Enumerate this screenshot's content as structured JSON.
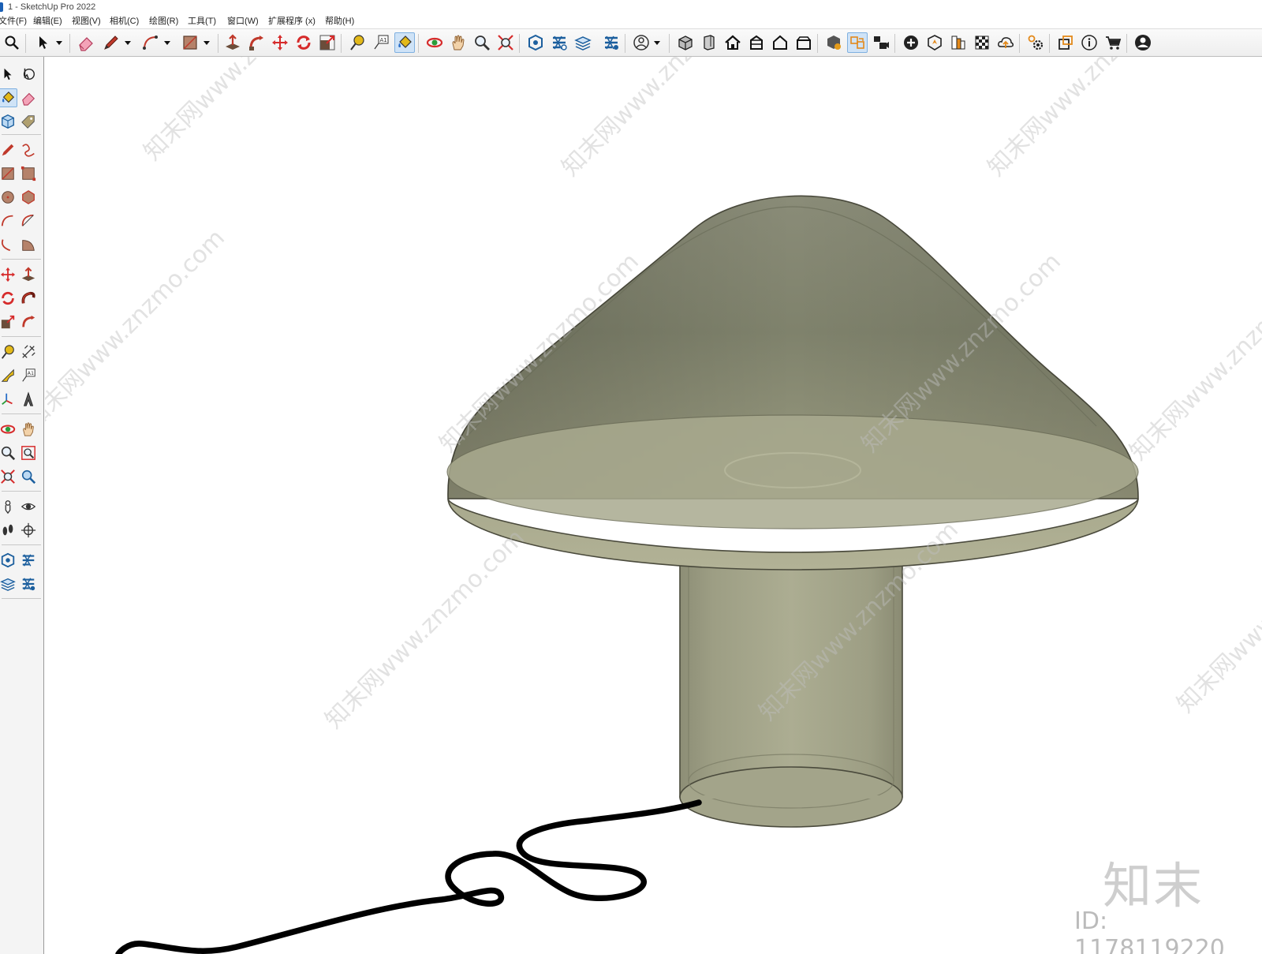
{
  "window": {
    "title": "1 - SketchUp Pro 2022"
  },
  "menu": {
    "items": [
      "文件(F)",
      "编辑(E)",
      "视图(V)",
      "相机(C)",
      "绘图(R)",
      "工具(T)",
      "窗口(W)",
      "扩展程序 (x)",
      "帮助(H)"
    ]
  },
  "toolbar": {
    "icons": [
      "search-icon",
      "select-icon",
      "eraser-icon",
      "pencil-icon",
      "arc-icon",
      "rectangle-icon",
      "push-pull-icon",
      "follow-me-icon",
      "move-icon",
      "rotate-icon",
      "scale-icon",
      "tape-measure-icon",
      "text-icon",
      "paint-bucket-icon",
      "orbit-icon",
      "pan-icon",
      "zoom-icon",
      "zoom-extents-icon",
      "warehouse-icon",
      "layers-icon",
      "user-icon",
      "home-view-icon",
      "shaded-view-icon",
      "info-icon",
      "cart-icon"
    ],
    "active": [
      "paint-bucket",
      "component-swap"
    ]
  },
  "viewport": {
    "model": "mushroom-table-lamp",
    "colors": {
      "shade": "#8a8c78",
      "shade_light": "#a6a68a",
      "base": "#a3a48a",
      "cord": "#000000",
      "background": "#ffffff"
    }
  },
  "watermark": {
    "text": "知末网www.znzmo.com",
    "brand": "知末",
    "id": "ID: 1178119220"
  }
}
